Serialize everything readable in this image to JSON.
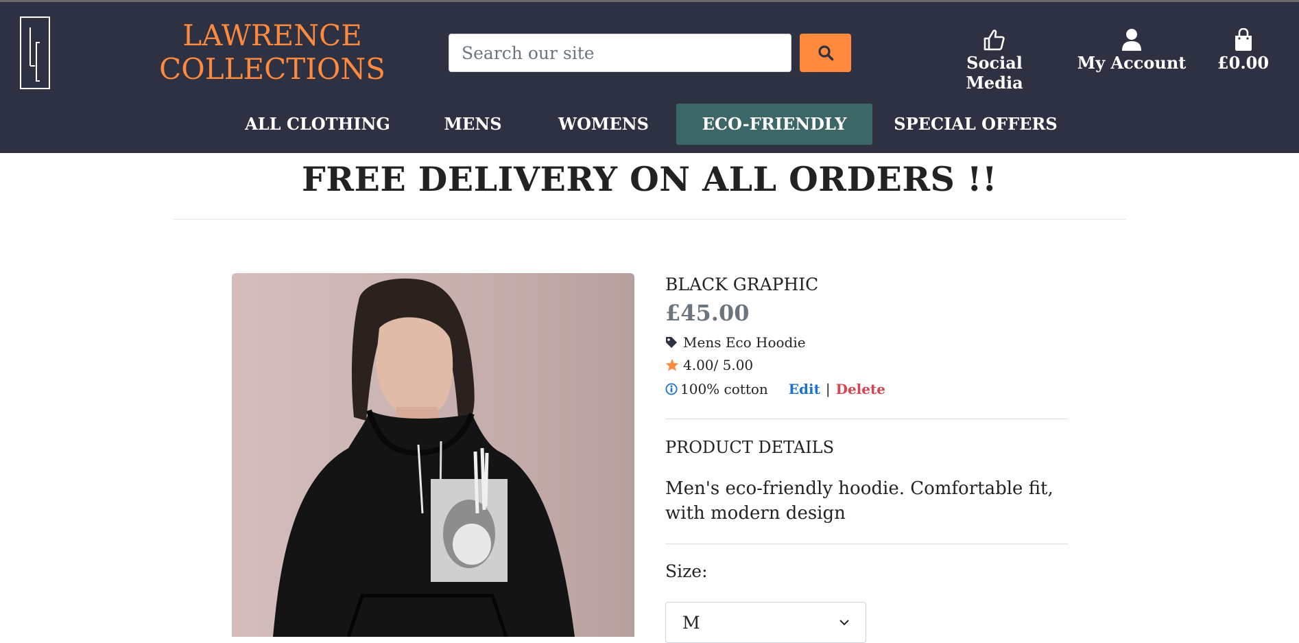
{
  "header": {
    "brand_line1": "LAWRENCE",
    "brand_line2": "COLLECTIONS",
    "search_placeholder": "Search our site",
    "social_label": "Social Media",
    "account_label": "My Account",
    "cart_total": "£0.00"
  },
  "menu": {
    "items": [
      "ALL CLOTHING",
      "MENS",
      "WOMENS",
      "ECO-FRIENDLY",
      "SPECIAL OFFERS"
    ],
    "active": "ECO-FRIENDLY"
  },
  "banner": {
    "text": "FREE DELIVERY ON ALL ORDERS !!"
  },
  "product": {
    "name": "BLACK GRAPHIC",
    "price": "£45.00",
    "category": "Mens Eco Hoodie",
    "rating": "4.00/ 5.00",
    "material": "100% cotton",
    "edit_label": "Edit",
    "separator": "|",
    "delete_label": "Delete",
    "details_heading": "PRODUCT DETAILS",
    "description": "Men's eco-friendly hoodie. Comfortable fit, with modern design",
    "size_label": "Size:",
    "size_value": "M"
  },
  "colors": {
    "header_bg": "#2d3142",
    "accent": "#ff8a3d",
    "active_menu": "#3d6666",
    "edit_link": "#1a73c8",
    "delete_link": "#d9454f"
  },
  "icons": {
    "logo": "lc-logo-icon",
    "search": "search-icon",
    "social": "thumbs-up-icon",
    "account": "user-icon",
    "cart": "shopping-bag-icon",
    "category": "tag-icon",
    "rating": "star-icon",
    "material": "info-circle-icon",
    "select": "chevron-down-icon"
  }
}
